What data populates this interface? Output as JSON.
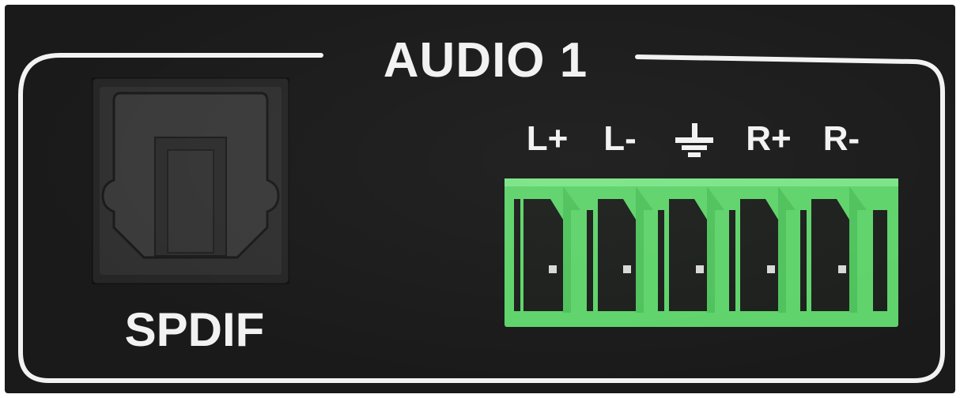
{
  "panel": {
    "section_title": "AUDIO 1",
    "spdif_label": "SPDIF",
    "pins": [
      {
        "label": "L+",
        "type": "text"
      },
      {
        "label": "L-",
        "type": "text"
      },
      {
        "label": "",
        "type": "ground",
        "icon": "ground-icon"
      },
      {
        "label": "R+",
        "type": "text"
      },
      {
        "label": "R-",
        "type": "text"
      }
    ],
    "colors": {
      "panel": "#1a1a1a",
      "text": "#f2f2f2",
      "terminal_green": "#5fd36b",
      "port_dark": "#2c2c2c"
    }
  }
}
